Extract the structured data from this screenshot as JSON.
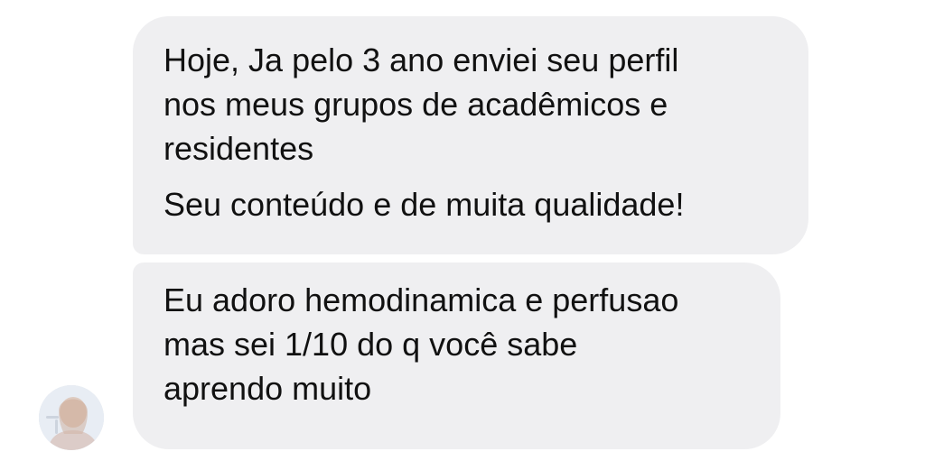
{
  "conversation": {
    "messages": [
      {
        "lines": [
          "Hoje, Ja pelo 3 ano enviei seu perfil",
          "nos meus grupos de acadêmicos e",
          "residentes",
          "Seu conteúdo e de muita qualidade!"
        ]
      },
      {
        "lines": [
          "Eu adoro hemodinamica e perfusao",
          "mas sei 1/10 do q você sabe",
          "aprendo muito"
        ]
      }
    ],
    "sender": {
      "avatar_icon": "user-avatar-photo"
    }
  },
  "colors": {
    "bubble_background": "#efeff1",
    "text": "#111111",
    "page_background": "#ffffff"
  }
}
